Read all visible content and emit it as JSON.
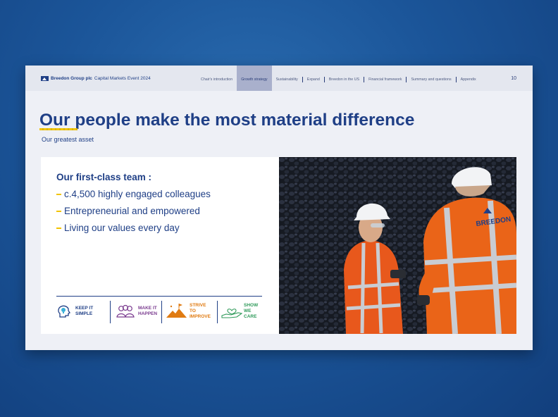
{
  "header": {
    "company": "Breedon Group plc",
    "event": "Capital Markets Event 2024",
    "nav": [
      {
        "label": "Chair's introduction",
        "active": false
      },
      {
        "label": "Growth strategy",
        "active": true
      },
      {
        "label": "Sustainability",
        "active": false
      },
      {
        "label": "Expand",
        "active": false
      },
      {
        "label": "Breedon in the US",
        "active": false
      },
      {
        "label": "Financial framework",
        "active": false
      },
      {
        "label": "Summary and questions",
        "active": false
      },
      {
        "label": "Appendix",
        "active": false
      }
    ],
    "page_number": "10"
  },
  "title": "Our people make the most material difference",
  "subtitle": "Our greatest asset",
  "team": {
    "heading": "Our first-class team :",
    "bullets": [
      "c.4,500 highly engaged colleagues",
      "Entrepreneurial and empowered",
      "Living our values every day"
    ]
  },
  "values": [
    {
      "label": "KEEP IT\nSIMPLE",
      "icon": "head-lightbulb-icon",
      "color": "#1f3f86"
    },
    {
      "label": "MAKE IT\nHAPPEN",
      "icon": "people-group-icon",
      "color": "#7a3b8f"
    },
    {
      "label": "STRIVE\nTO\nIMPROVE",
      "icon": "mountain-flag-icon",
      "color": "#e07b12"
    },
    {
      "label": "SHOW\nWE\nCARE",
      "icon": "hand-heart-icon",
      "color": "#2f9a5a"
    }
  ],
  "photo": {
    "vest_text": "BREEDON"
  },
  "colors": {
    "brand_blue": "#1f3f86",
    "accent_yellow": "#f2c300",
    "nav_active": "#a9b0cc"
  }
}
